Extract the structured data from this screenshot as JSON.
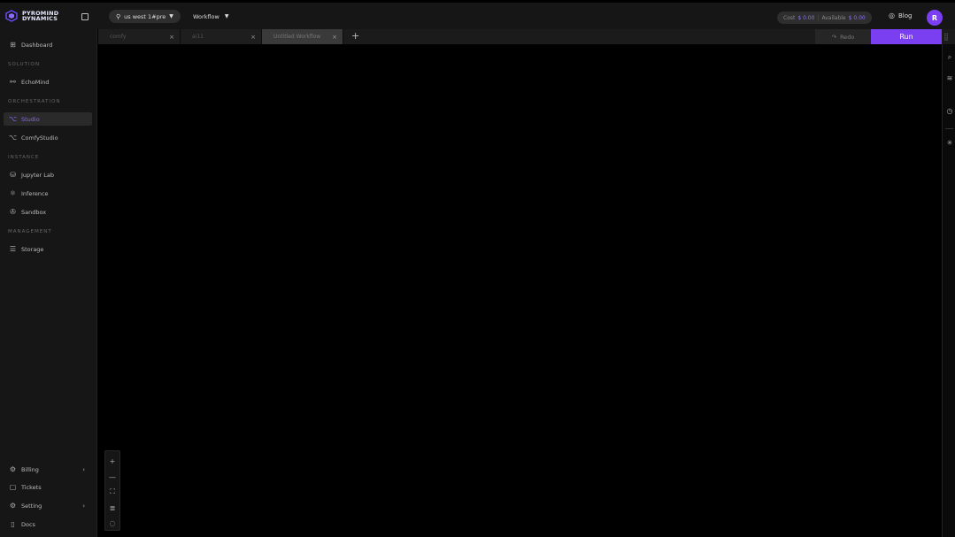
{
  "brand": {
    "line1": "PYROMIND",
    "line2": "DYNAMICS"
  },
  "header": {
    "region": "us west 1#pre",
    "workflow_label": "Workflow",
    "cost_label": "Cost",
    "cost_value": "$ 0.00",
    "available_label": "Available",
    "available_value": "$ 0.00",
    "blog_label": "Blog",
    "avatar_initial": "R"
  },
  "sidebar": {
    "dashboard": "Dashboard",
    "section_solution": "SOLUTION",
    "echomind": "EchoMind",
    "section_orchestration": "ORCHESTRATION",
    "studio": "Studio",
    "comfystudio": "ComfyStudio",
    "section_instance": "INSTANCE",
    "jupyterlab": "Jupyter Lab",
    "inference": "Inference",
    "sandbox": "Sandbox",
    "section_management": "MANAGEMENT",
    "storage": "Storage",
    "billing": "Billing",
    "tickets": "Tickets",
    "setting": "Setting",
    "docs": "Docs"
  },
  "tabs": {
    "tab1": "comfy",
    "tab2": "ai11",
    "tab3": "Untitled Workflow",
    "redo": "Redo",
    "run": "Run"
  },
  "colors": {
    "accent": "#7b3ff2",
    "active_text": "#8d63ff",
    "bg": "#000000",
    "panel": "#161616"
  }
}
